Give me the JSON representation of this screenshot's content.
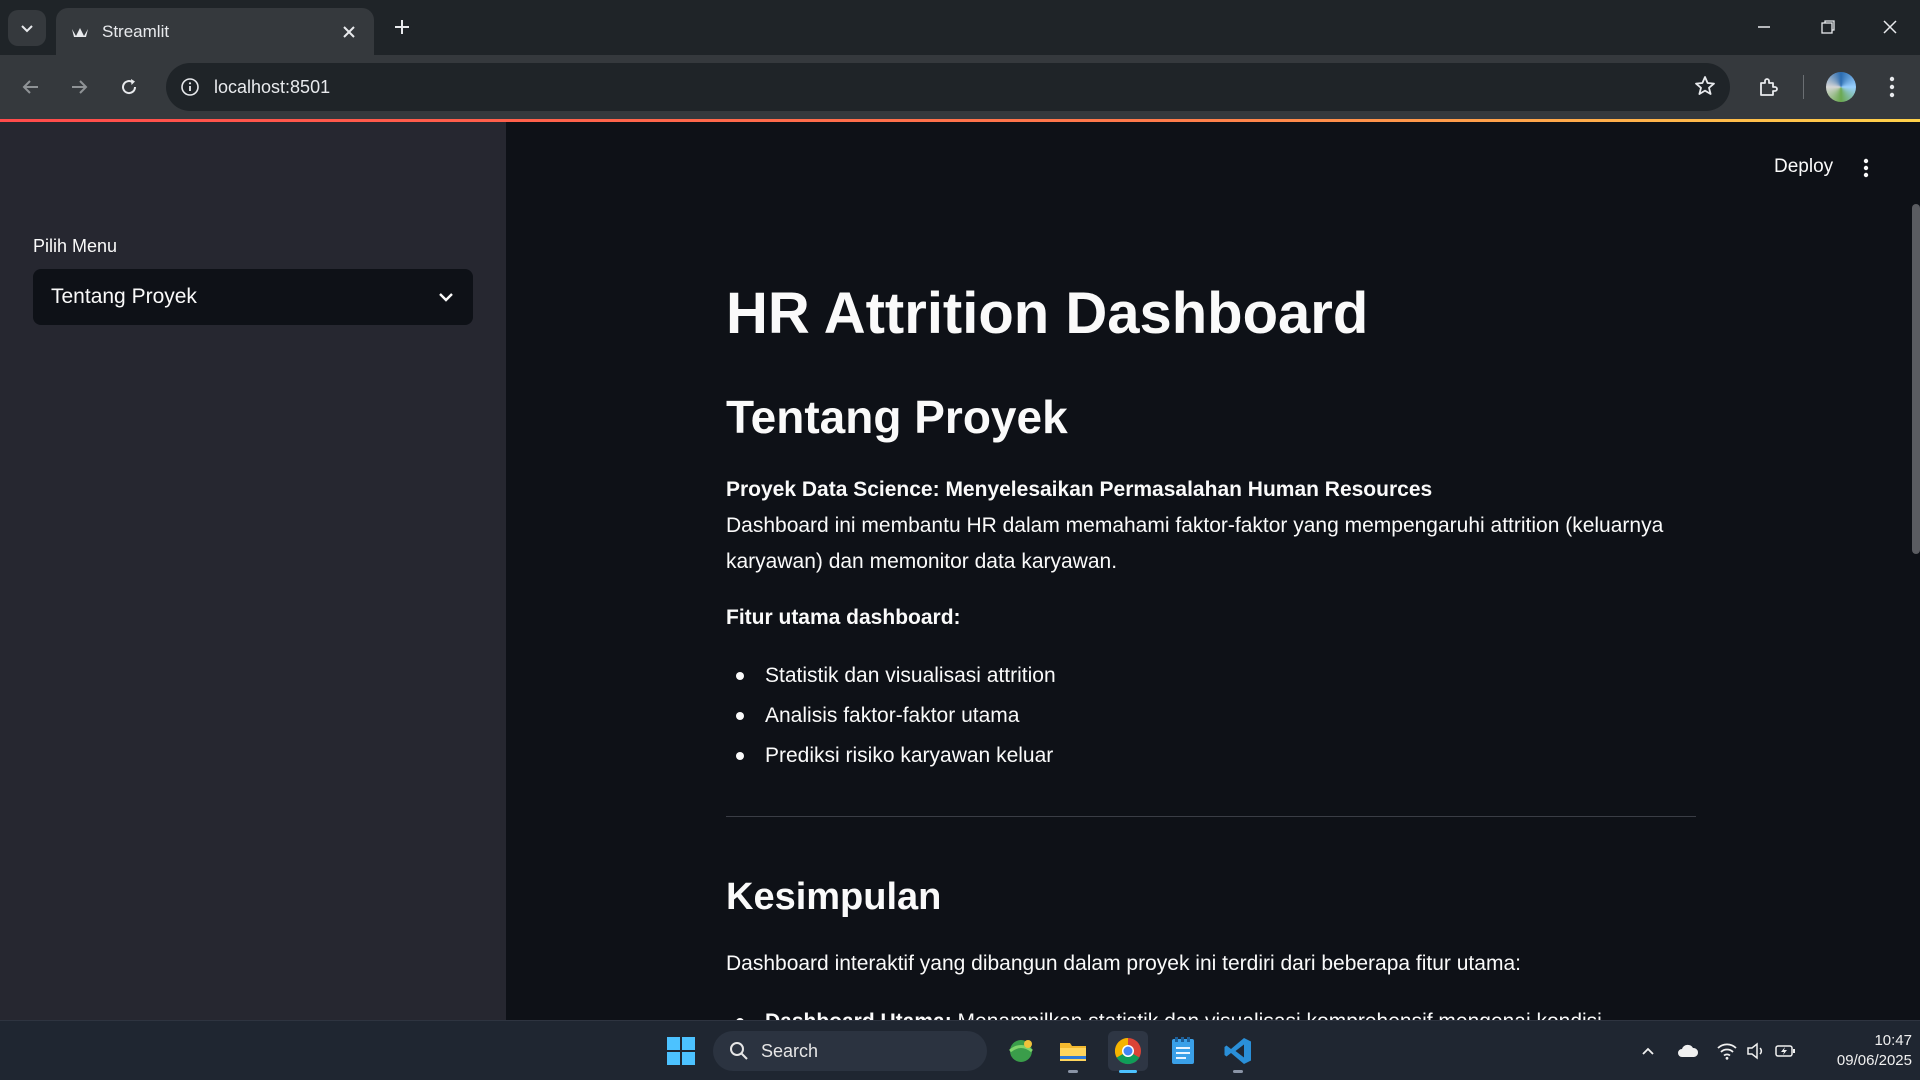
{
  "browser": {
    "tab_title": "Streamlit",
    "url": "localhost:8501"
  },
  "app": {
    "deploy_label": "Deploy"
  },
  "sidebar": {
    "select_label": "Pilih Menu",
    "selected_option": "Tentang Proyek"
  },
  "main": {
    "title": "HR Attrition Dashboard",
    "section_title": "Tentang Proyek",
    "project_bold": "Proyek Data Science: Menyelesaikan Permasalahan Human Resources",
    "project_desc": "Dashboard ini membantu HR dalam memahami faktor-faktor yang mempengaruhi attrition (keluarnya karyawan) dan memonitor data karyawan.",
    "features_heading": "Fitur utama dashboard:",
    "features": [
      "Statistik dan visualisasi attrition",
      "Analisis faktor-faktor utama",
      "Prediksi risiko karyawan keluar"
    ],
    "conclusion_title": "Kesimpulan",
    "conclusion_text": "Dashboard interaktif yang dibangun dalam proyek ini terdiri dari beberapa fitur utama:",
    "conclusion_item_bold": "Dashboard Utama:",
    "conclusion_item_text": " Menampilkan statistik dan visualisasi komprehensif mengenai kondisi karyawan"
  },
  "taskbar": {
    "search_label": "Search",
    "time": "10:47",
    "date": "09/06/2025"
  },
  "colors": {
    "app_bg": "#0e1117",
    "sidebar_bg": "#262730",
    "accent": "#ff4b4b"
  }
}
